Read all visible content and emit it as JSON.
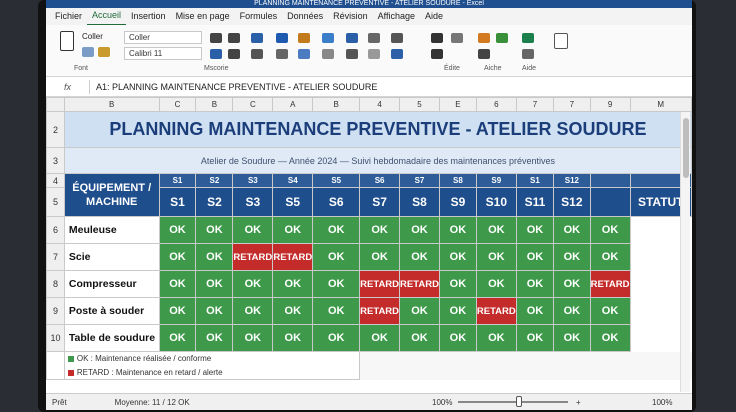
{
  "app": {
    "title": "PLANNING MAINTENANCE PREVENTIVE - ATELIER SOUDURE - Excel"
  },
  "menu": [
    "Fichier",
    "Accueil",
    "Insertion",
    "Mise en page",
    "Formules",
    "Données",
    "Révision",
    "Affichage",
    "Aide"
  ],
  "ribbon": {
    "paste": "Coller",
    "style_box": "Coller",
    "font_box": "Calibri 11",
    "group_font": "Font",
    "group_align": "Mscorie",
    "group_edit": "Édite",
    "group_aide": "Aiche",
    "group_aide2": "Aide"
  },
  "formula": {
    "fx": "fx",
    "text": "A1: PLANNING MAINTENANCE PREVENTIVE - ATELIER SOUDURE"
  },
  "grid": {
    "col_headers": [
      "B",
      "C",
      "B",
      "C",
      "A",
      "B",
      "4",
      "5",
      "E",
      "6",
      "7",
      "7",
      "9",
      "M"
    ],
    "row_numbers": [
      "2",
      "3",
      "4",
      "5",
      "6",
      "7",
      "8",
      "9",
      "10"
    ]
  },
  "sheet": {
    "title": "PLANNING MAINTENANCE PREVENTIVE - ATELIER SOUDURE",
    "subtitle": "Atelier de Soudure — Année 2024 — Suivi hebdomadaire des maintenances préventives",
    "equipment_header": "ÉQUIPEMENT / MACHINE",
    "weeks_small": [
      "S1",
      "S2",
      "S3",
      "S4",
      "S5",
      "S6",
      "S7",
      "S8",
      "S9",
      "S1",
      "S12",
      ""
    ],
    "week_headers": [
      "S1",
      "S2",
      "S3",
      "S5",
      "S6",
      "S7",
      "S8",
      "S9",
      "S10",
      "S11",
      "S12"
    ],
    "status_header": "STATUT",
    "rows": [
      {
        "num": "6",
        "name": "Meuleuse",
        "cells": [
          "OK",
          "OK",
          "OK",
          "OK",
          "OK",
          "OK",
          "OK",
          "OK",
          "OK",
          "OK",
          "OK",
          "OK"
        ]
      },
      {
        "num": "7",
        "name": "Scie",
        "cells": [
          "OK",
          "OK",
          "RETARD",
          "RETARD",
          "OK",
          "OK",
          "OK",
          "OK",
          "OK",
          "OK",
          "OK",
          "OK"
        ]
      },
      {
        "num": "8",
        "name": "Compresseur",
        "cells": [
          "OK",
          "OK",
          "OK",
          "OK",
          "OK",
          "RETARD",
          "RETARD",
          "OK",
          "OK",
          "OK",
          "OK",
          "RETARD"
        ]
      },
      {
        "num": "9",
        "name": "Poste à souder",
        "cells": [
          "OK",
          "OK",
          "OK",
          "OK",
          "OK",
          "RETARD",
          "OK",
          "OK",
          "RETARD",
          "OK",
          "OK",
          "OK"
        ]
      },
      {
        "num": "10",
        "name": "Table de soudure",
        "cells": [
          "OK",
          "OK",
          "OK",
          "OK",
          "OK",
          "OK",
          "OK",
          "OK",
          "OK",
          "OK",
          "OK",
          "OK"
        ]
      }
    ],
    "legend": [
      "OK : Maintenance réalisée / conforme",
      "RETARD : Maintenance en retard / alerte"
    ]
  },
  "status": {
    "ready": "Prêt",
    "average": "Moyenne: 11 / 12 OK",
    "zoom": "100%",
    "plus": "+"
  },
  "colors": {
    "ok": "#3e9a4a",
    "retard": "#c42b2b",
    "header": "#1f4e8c",
    "title_bg": "#cfe0f3"
  }
}
